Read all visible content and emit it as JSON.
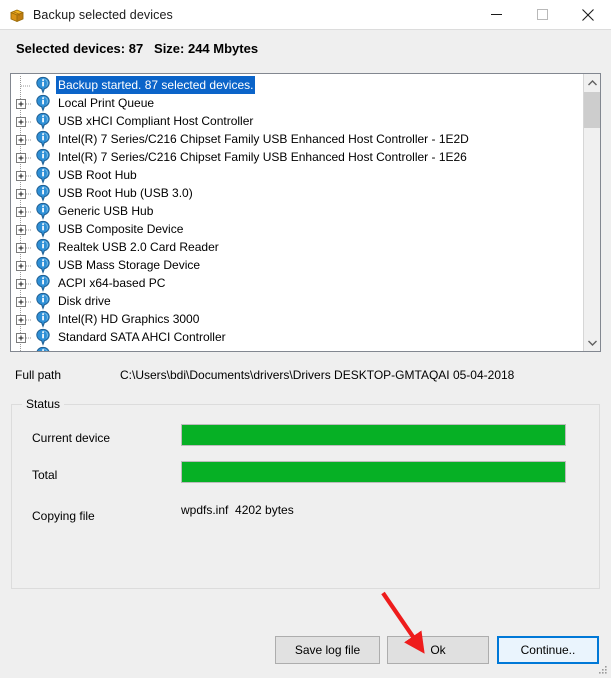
{
  "window": {
    "title": "Backup selected devices",
    "icon": "package-box-icon",
    "controls": {
      "minimize": "minimize-icon",
      "maximize": "maximize-icon",
      "close": "close-icon"
    }
  },
  "summary": {
    "text": "Selected devices: 87   Size: 244 Mbytes",
    "selected_devices": 87,
    "size": "244 Mbytes"
  },
  "tree": {
    "rows": [
      {
        "label": "Backup started. 87 selected devices.",
        "expandable": false,
        "selected": true
      },
      {
        "label": "Local Print Queue",
        "expandable": true,
        "selected": false
      },
      {
        "label": "USB xHCI Compliant Host Controller",
        "expandable": true,
        "selected": false
      },
      {
        "label": "Intel(R) 7 Series/C216 Chipset Family USB Enhanced Host Controller - 1E2D",
        "expandable": true,
        "selected": false
      },
      {
        "label": "Intel(R) 7 Series/C216 Chipset Family USB Enhanced Host Controller - 1E26",
        "expandable": true,
        "selected": false
      },
      {
        "label": "USB Root Hub",
        "expandable": true,
        "selected": false
      },
      {
        "label": "USB Root Hub (USB 3.0)",
        "expandable": true,
        "selected": false
      },
      {
        "label": "Generic USB Hub",
        "expandable": true,
        "selected": false
      },
      {
        "label": "USB Composite Device",
        "expandable": true,
        "selected": false
      },
      {
        "label": "Realtek USB 2.0 Card Reader",
        "expandable": true,
        "selected": false
      },
      {
        "label": "USB Mass Storage Device",
        "expandable": true,
        "selected": false
      },
      {
        "label": "ACPI x64-based PC",
        "expandable": true,
        "selected": false
      },
      {
        "label": "Disk drive",
        "expandable": true,
        "selected": false
      },
      {
        "label": "Intel(R) HD Graphics 3000",
        "expandable": true,
        "selected": false
      },
      {
        "label": "Standard SATA AHCI Controller",
        "expandable": true,
        "selected": false
      },
      {
        "label": "",
        "expandable": true,
        "selected": false
      }
    ],
    "selection_color": "#0b64c9",
    "item_icon": "info-balloon-icon",
    "expander_icon": "plus-box-icon"
  },
  "fullpath": {
    "label": "Full path",
    "value": "C:\\Users\\bdi\\Documents\\drivers\\Drivers DESKTOP-GMTAQAI 05-04-2018"
  },
  "status": {
    "legend": "Status",
    "current_device": {
      "label": "Current device",
      "percent": 100
    },
    "total": {
      "label": "Total",
      "percent": 100
    },
    "copying": {
      "label": "Copying file",
      "value": "wpdfs.inf  4202 bytes"
    },
    "bar_color": "#06b025"
  },
  "buttons": {
    "save_log": "Save log file",
    "ok": "Ok",
    "continue": "Continue..",
    "focus_color": "#0078d7"
  },
  "annotation": {
    "arrow_color": "#ee1c1c",
    "points_to": "ok-button"
  }
}
